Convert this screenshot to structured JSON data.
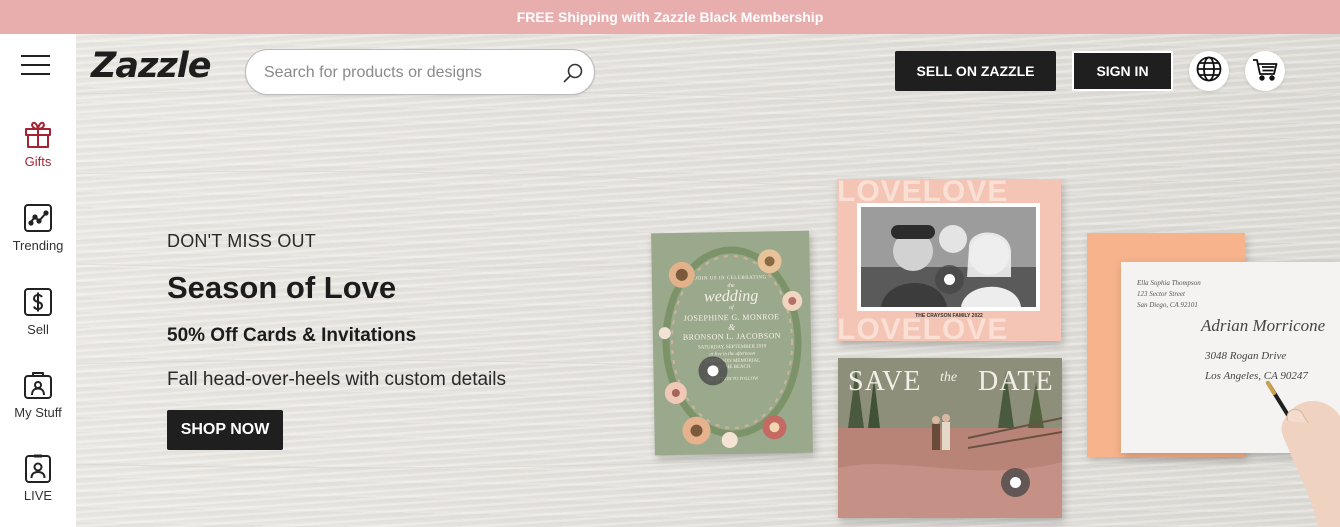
{
  "promo": {
    "text": "FREE Shipping with Zazzle Black Membership"
  },
  "header": {
    "logo": "Zazzle",
    "search": {
      "placeholder": "Search for products or designs",
      "value": ""
    },
    "sell_label": "SELL ON ZAZZLE",
    "signin_label": "SIGN IN",
    "icons": [
      "menu-icon",
      "search-icon",
      "globe-icon",
      "cart-icon"
    ]
  },
  "sidebar": {
    "items": [
      {
        "label": "Gifts",
        "icon": "gift-icon",
        "active": true
      },
      {
        "label": "Trending",
        "icon": "trending-icon"
      },
      {
        "label": "Sell",
        "icon": "dollar-icon"
      },
      {
        "label": "My Stuff",
        "icon": "my-stuff-icon"
      },
      {
        "label": "LIVE",
        "icon": "live-icon"
      }
    ]
  },
  "hero": {
    "eyebrow": "DON'T MISS OUT",
    "headline": "Season of Love",
    "subhead": "50% Off Cards & Invitations",
    "tagline": "Fall head-over-heels with custom details",
    "cta": "SHOP NOW",
    "wedding_card": {
      "line1": "JOIN US IN CELEBRATING",
      "script": "wedding",
      "the": "the",
      "of": "of",
      "name1": "JOSEPHINE G. MONROE",
      "amp": "&",
      "name2": "BRONSON L. JACOBSON",
      "date": "SATURDAY, SEPTEMBER 2019",
      "time": "at five in the afternoon",
      "place": "ANDERSON MEMORIAL",
      "city": "ON THE BEACH",
      "reception": "RECEPTION TO FOLLOW"
    },
    "love_card": {
      "pattern": "LOVELOVE",
      "caption": "THE CRAYSON FAMILY 2022"
    },
    "save_card": {
      "save": "SAVE",
      "the": "the",
      "date": "DATE"
    },
    "envelope": {
      "return_lines": [
        "Ella Sophia Thompson",
        "123 Sector Street",
        "San Diego, CA 92101"
      ],
      "recipient_lines": [
        "Adrian Morricone",
        "3048 Rogan Drive",
        "Los Angeles, CA 90247"
      ]
    },
    "colors": {
      "promo": "#e8aeae",
      "accent": "#a52434",
      "button": "#1f1f1f"
    }
  }
}
